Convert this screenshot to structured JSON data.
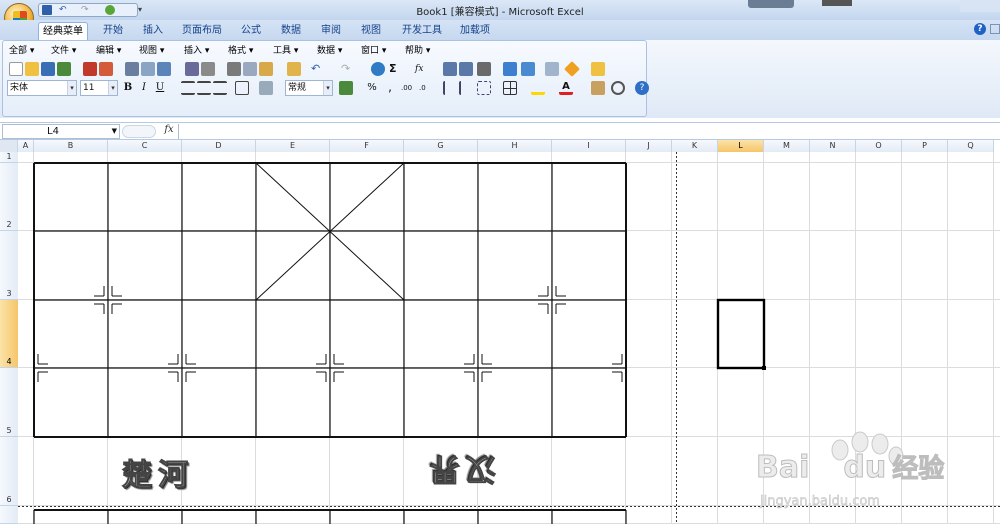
{
  "window": {
    "title": "Book1  [兼容模式] - Microsoft Excel"
  },
  "ribbon_tabs": [
    "经典菜单",
    "开始",
    "插入",
    "页面布局",
    "公式",
    "数据",
    "审阅",
    "视图",
    "开发工具",
    "加载项"
  ],
  "menus": [
    "全部",
    "文件",
    "编辑",
    "视图",
    "插入",
    "格式",
    "工具",
    "数据",
    "窗口",
    "帮助"
  ],
  "font": {
    "name": "宋体",
    "size": "11",
    "number_format": "常规"
  },
  "format_buttons": {
    "bold": "B",
    "italic": "I",
    "underline": "U",
    "percent": "%",
    "comma": ",",
    "fx": "fx",
    "sigma": "Σ"
  },
  "formula_bar": {
    "cell_ref": "L4",
    "fx_label": "fx",
    "content": ""
  },
  "columns": [
    "A",
    "B",
    "C",
    "D",
    "E",
    "F",
    "G",
    "H",
    "I",
    "J",
    "K",
    "L",
    "M",
    "N",
    "O",
    "P",
    "Q"
  ],
  "selected_column": "L",
  "rows": [
    "1",
    "2",
    "3",
    "4",
    "5",
    "6"
  ],
  "selected_row": "4",
  "board_text": {
    "left": "楚河",
    "right": "汉界"
  },
  "watermark": {
    "brand": "Bai",
    "brand2": "du",
    "brand3": "经验",
    "url": "jingyan.baidu.com"
  },
  "colors": {
    "accent": "#15428b",
    "selection": "#f6c56a",
    "grid": "#dcdcdc"
  }
}
